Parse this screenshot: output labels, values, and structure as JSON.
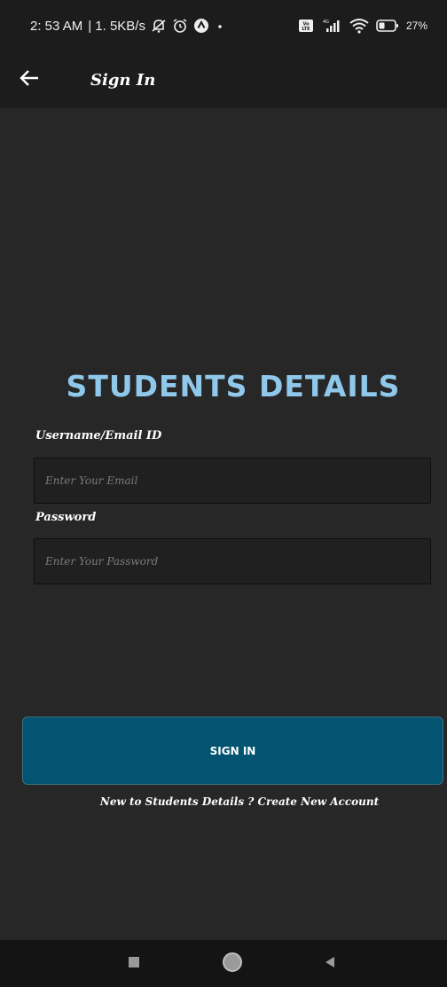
{
  "status_bar": {
    "time": "2: 53 AM",
    "network_speed": "| 1. 5KB/s",
    "battery_percent": "27%",
    "icons": [
      "muted-bell-icon",
      "alarm-icon",
      "navigation-icon",
      "dot-icon",
      "volte-icon",
      "signal-4g-icon",
      "wifi-icon",
      "battery-icon"
    ]
  },
  "app_bar": {
    "back_icon": "arrow-left-icon",
    "title": "Sign In"
  },
  "brand": {
    "title": "STUDENTS DETAILS",
    "color": "#8fc8ea"
  },
  "form": {
    "username_label": "Username/Email ID",
    "username_placeholder": "Enter Your Email",
    "username_value": "",
    "password_label": "Password",
    "password_placeholder": "Enter Your Password",
    "password_value": ""
  },
  "actions": {
    "signin_label": "SIGN IN",
    "signin_color": "#025470",
    "signup_prompt": "New to Students Details ?",
    "signup_link": "Create New Account"
  },
  "nav_bar": {
    "buttons": [
      "recents-square-icon",
      "home-circle-icon",
      "back-triangle-icon"
    ]
  }
}
